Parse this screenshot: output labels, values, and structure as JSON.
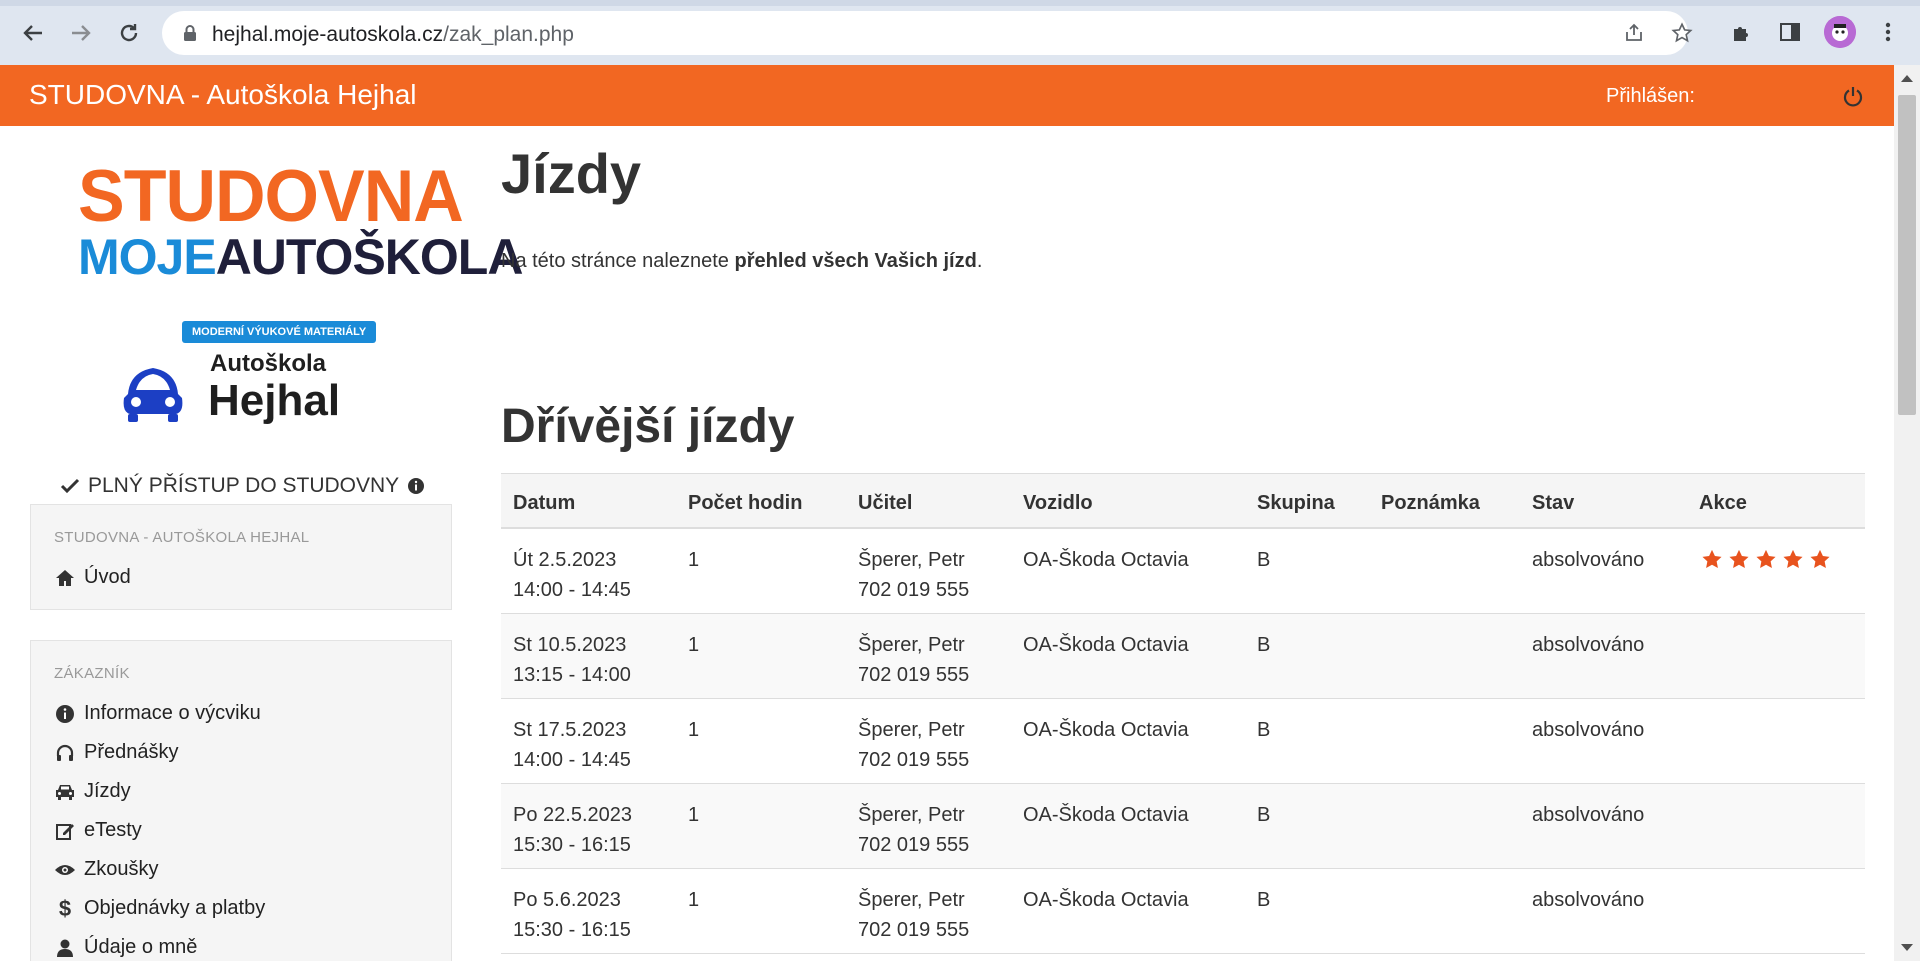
{
  "browser": {
    "url_host": "hejhal.moje-autoskola.cz",
    "url_path": "/zak_plan.php"
  },
  "header": {
    "title": "STUDOVNA - Autoškola Hejhal",
    "login_label": "Přihlášen:"
  },
  "sidebar": {
    "logo_line1": "STUDOVNA",
    "logo_moje": "MOJE",
    "logo_autoskola": "AUTOŠKOLA",
    "logo_tagline": "MODERNÍ VÝUKOVÉ MATERIÁLY",
    "school_logo_line1": "Autoškola",
    "school_logo_line2": "Hejhal",
    "access_text": "PLNÝ PŘÍSTUP DO STUDOVNY",
    "panel1": {
      "heading": "STUDOVNA - AUTOŠKOLA HEJHAL",
      "items": [
        {
          "label": "Úvod",
          "icon": "home-icon"
        }
      ]
    },
    "panel2": {
      "heading": "ZÁKAZNÍK",
      "items": [
        {
          "label": "Informace o výcviku",
          "icon": "info-icon"
        },
        {
          "label": "Přednášky",
          "icon": "headphones-icon"
        },
        {
          "label": "Jízdy",
          "icon": "car-icon"
        },
        {
          "label": "eTesty",
          "icon": "edit-icon"
        },
        {
          "label": "Zkoušky",
          "icon": "eye-icon"
        },
        {
          "label": "Objednávky a platby",
          "icon": "dollar-icon"
        },
        {
          "label": "Údaje o mně",
          "icon": "user-icon"
        }
      ]
    }
  },
  "main": {
    "title": "Jízdy",
    "intro_prefix": "Na této stránce naleznete ",
    "intro_bold": "přehled všech Vašich jízd",
    "intro_suffix": ".",
    "section_title": "Dřívější jízdy",
    "columns": [
      "Datum",
      "Počet hodin",
      "Učitel",
      "Vozidlo",
      "Skupina",
      "Poznámka",
      "Stav",
      "Akce"
    ],
    "rows": [
      {
        "date": "Út 2.5.2023",
        "time": "14:00 - 14:45",
        "hours": "1",
        "teacher": "Šperer, Petr",
        "phone": "702 019 555",
        "vehicle": "OA-Škoda Octavia",
        "group": "B",
        "note": "",
        "status": "absolvováno",
        "rating": 5
      },
      {
        "date": "St 10.5.2023",
        "time": "13:15 - 14:00",
        "hours": "1",
        "teacher": "Šperer, Petr",
        "phone": "702 019 555",
        "vehicle": "OA-Škoda Octavia",
        "group": "B",
        "note": "",
        "status": "absolvováno",
        "rating": 0
      },
      {
        "date": "St 17.5.2023",
        "time": "14:00 - 14:45",
        "hours": "1",
        "teacher": "Šperer, Petr",
        "phone": "702 019 555",
        "vehicle": "OA-Škoda Octavia",
        "group": "B",
        "note": "",
        "status": "absolvováno",
        "rating": 0
      },
      {
        "date": "Po 22.5.2023",
        "time": "15:30 - 16:15",
        "hours": "1",
        "teacher": "Šperer, Petr",
        "phone": "702 019 555",
        "vehicle": "OA-Škoda Octavia",
        "group": "B",
        "note": "",
        "status": "absolvováno",
        "rating": 0
      },
      {
        "date": "Po 5.6.2023",
        "time": "15:30 - 16:15",
        "hours": "1",
        "teacher": "Šperer, Petr",
        "phone": "702 019 555",
        "vehicle": "OA-Škoda Octavia",
        "group": "B",
        "note": "",
        "status": "absolvováno",
        "rating": 0
      }
    ]
  },
  "colors": {
    "brand_orange": "#f26722",
    "brand_blue": "#1a8bd8",
    "star": "#e8531e"
  }
}
